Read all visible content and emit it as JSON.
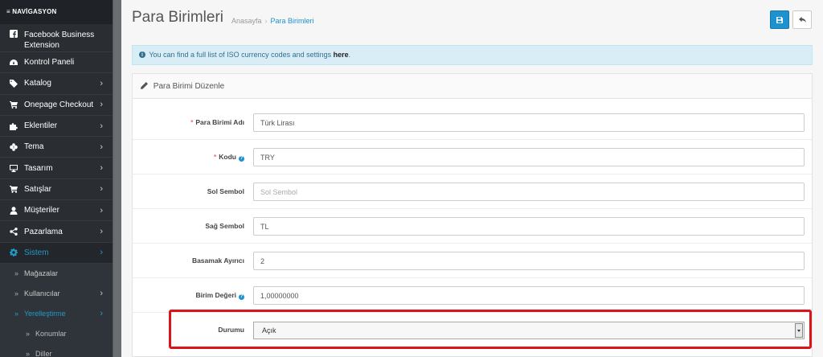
{
  "sidebar": {
    "header": "≡ NAVİGASYON",
    "items": [
      {
        "label": "Facebook Business Extension",
        "icon": "facebook-square-icon"
      },
      {
        "label": "Kontrol Paneli",
        "icon": "dashboard-icon"
      },
      {
        "label": "Katalog",
        "icon": "tag-icon",
        "chevron": "›"
      },
      {
        "label": "Onepage Checkout",
        "icon": "cart-icon",
        "chevron": "›"
      },
      {
        "label": "Eklentiler",
        "icon": "puzzle-icon",
        "chevron": "›"
      },
      {
        "label": "Tema",
        "icon": "brush-icon",
        "chevron": "›"
      },
      {
        "label": "Tasarım",
        "icon": "monitor-icon",
        "chevron": "›"
      },
      {
        "label": "Satışlar",
        "icon": "cart-icon",
        "chevron": "›"
      },
      {
        "label": "Müşteriler",
        "icon": "user-icon",
        "chevron": "›"
      },
      {
        "label": "Pazarlama",
        "icon": "share-icon",
        "chevron": "›"
      },
      {
        "label": "Sistem",
        "icon": "gear-icon",
        "chevron": "›",
        "active": true
      }
    ],
    "sub_items": [
      {
        "label": "Mağazalar",
        "bullet": "»"
      },
      {
        "label": "Kullanıcılar",
        "bullet": "»",
        "chevron": "›"
      },
      {
        "label": "Yerelleştirme",
        "bullet": "»",
        "chevron": "›",
        "active": true
      }
    ],
    "sub_sub_items": [
      {
        "label": "Konumlar",
        "bullet": "»"
      },
      {
        "label": "Diller",
        "bullet": "»"
      }
    ]
  },
  "header": {
    "title": "Para Birimleri",
    "breadcrumb": [
      "Anasayfa",
      "Para Birimleri"
    ],
    "breadcrumb_sep": "›"
  },
  "alert": {
    "text": "You can find a full list of ISO currency codes and settings",
    "link": "here",
    "end": "."
  },
  "panel": {
    "title": "Para Birimi Düzenle"
  },
  "form": {
    "fields": [
      {
        "label": "Para Birimi Adı",
        "required": true,
        "value": "Türk Lirası",
        "placeholder": "Para Birimi Adı"
      },
      {
        "label": "Kodu",
        "required": true,
        "help": "?",
        "value": "TRY",
        "placeholder": "Kodu"
      },
      {
        "label": "Sol Sembol",
        "value": "",
        "placeholder": "Sol Sembol"
      },
      {
        "label": "Sağ Sembol",
        "value": "TL",
        "placeholder": "Sağ Sembol"
      },
      {
        "label": "Basamak Ayırıcı",
        "value": "2",
        "placeholder": "Basamak Ayırıcı"
      },
      {
        "label": "Birim Değeri",
        "help": "?",
        "value": "1,00000000",
        "placeholder": "Birim Değeri"
      },
      {
        "label": "Durumu",
        "type": "select",
        "value": "Açık"
      }
    ],
    "required_mark": "*"
  },
  "colors": {
    "accent": "#1e91cf",
    "sidebar_bg": "#2a2e33",
    "highlight": "#d9151b"
  }
}
